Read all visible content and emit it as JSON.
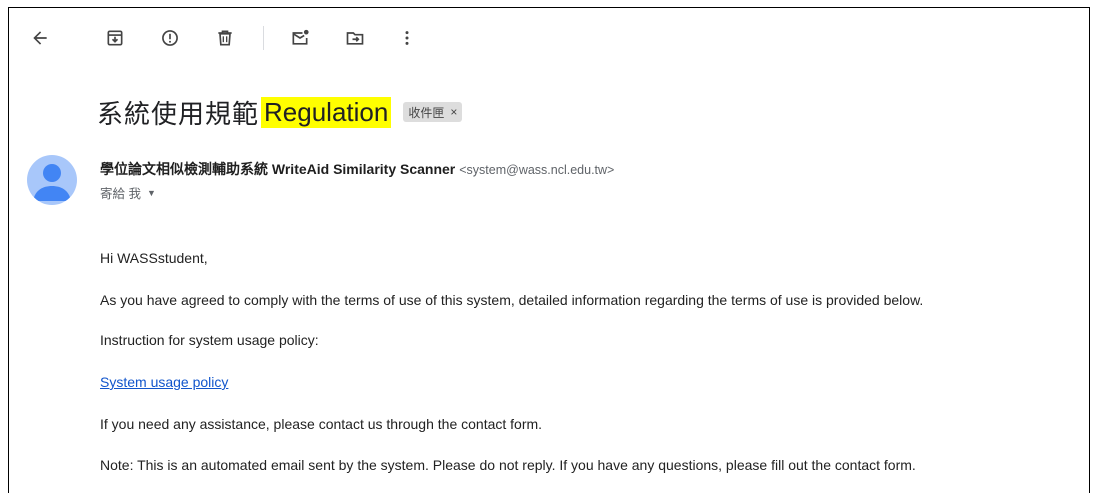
{
  "toolbar": {
    "back": "arrow-back-icon",
    "archive": "archive-icon",
    "spam": "report-spam-icon",
    "delete": "delete-icon",
    "mark_unread": "mark-unread-icon",
    "move": "move-to-icon",
    "more": "more-vert-icon"
  },
  "email": {
    "subject_zh": "系統使用規範",
    "subject_en": "Regulation",
    "label": "收件匣",
    "label_close": "×",
    "sender_name": "學位論文相似檢測輔助系統 WriteAid Similarity Scanner",
    "sender_email": "<system@wass.ncl.edu.tw>",
    "to": "寄給 我",
    "to_caret": "▼",
    "body": {
      "greeting": "Hi WASSstudent,",
      "line1": "As you have agreed to comply with the terms of use of this system, detailed information regarding the terms of use is provided below.",
      "line2": "Instruction for system usage policy:",
      "link": "System usage policy",
      "line3": "If you need any assistance, please contact us through the contact form.",
      "note": "Note: This is an automated email sent by the system. Please do not reply. If you have any questions, please fill out the contact form."
    }
  },
  "colors": {
    "highlight": "#ffff00",
    "link": "#1155cc",
    "avatar_bg": "#a8c7fa",
    "avatar_fg": "#4285f4"
  }
}
